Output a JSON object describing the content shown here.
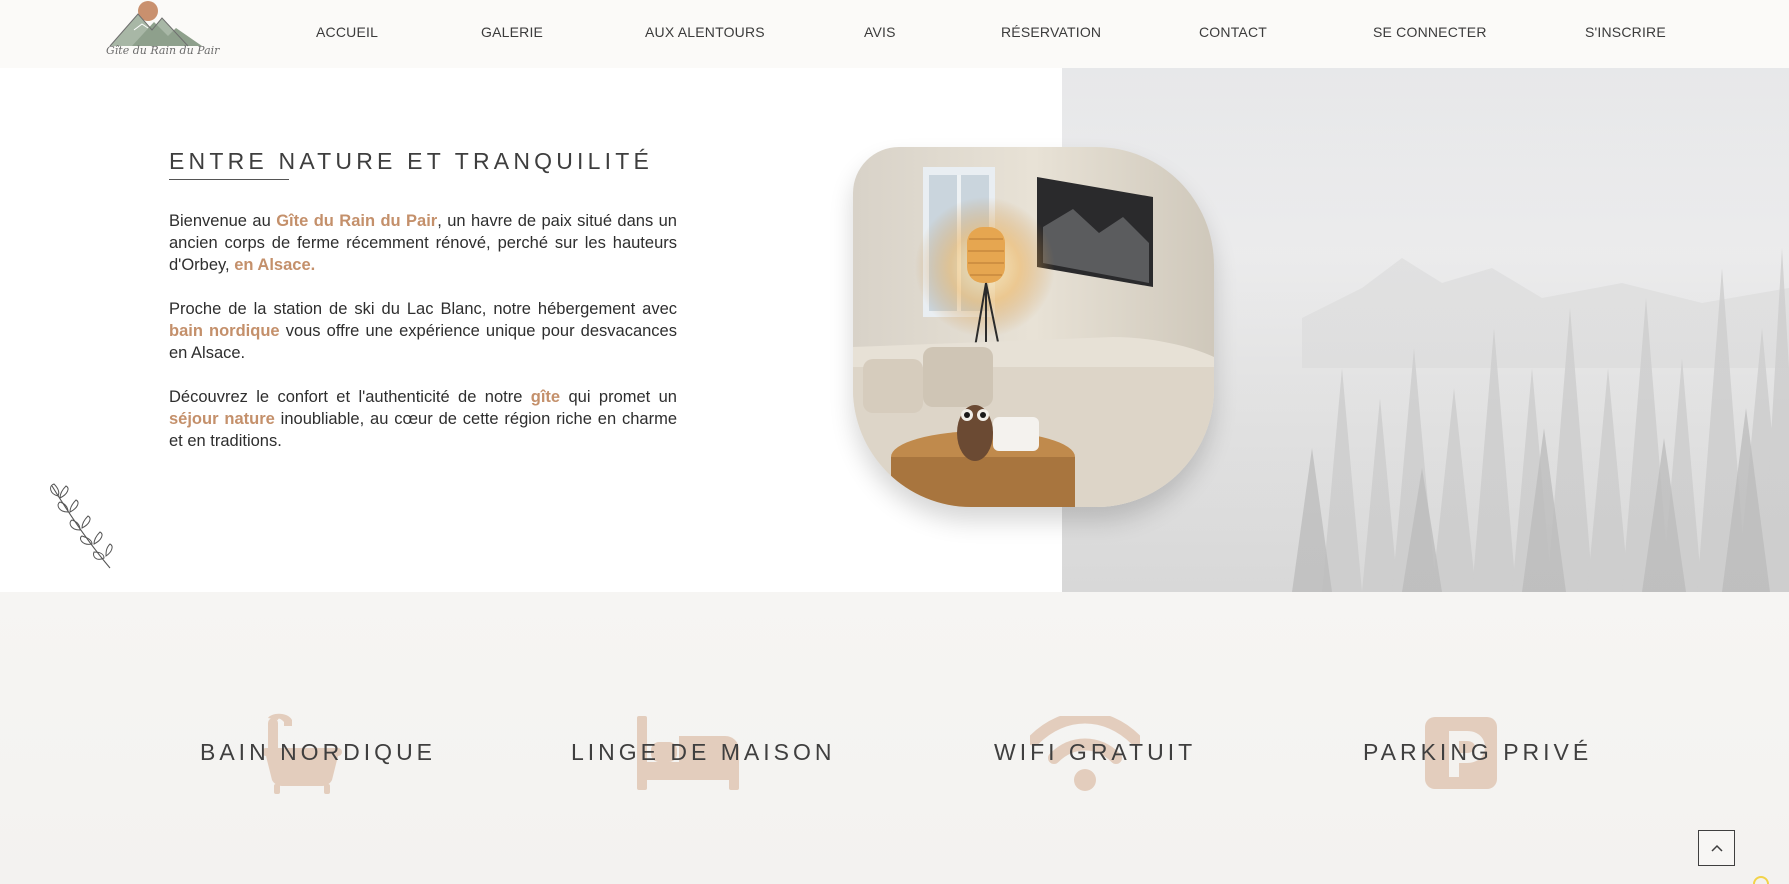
{
  "logo": {
    "text": "Gîte du Rain du Pair"
  },
  "nav": {
    "items": [
      "ACCUEIL",
      "GALERIE",
      "AUX ALENTOURS",
      "AVIS",
      "RÉSERVATION",
      "CONTACT",
      "SE CONNECTER",
      "S'INSCRIRE"
    ]
  },
  "hero": {
    "title": "ENTRE NATURE ET TRANQUILITÉ",
    "p1": {
      "a": "Bienvenue au ",
      "b": "Gîte du Rain du Pair",
      "c": ", un havre de paix situé dans un ancien corps de ferme récemment rénové, perché sur les hauteurs d'Orbey, ",
      "d": "en Alsace."
    },
    "p2": {
      "a": "Proche de la station de ski du Lac Blanc, notre hébergement avec ",
      "b": "bain nordique",
      "c": " vous offre une expérience unique pour desvacances en Alsace."
    },
    "p3": {
      "a": "Découvrez le confort et l'authenticité de notre ",
      "b": "gîte",
      "c": " qui promet un ",
      "d": "séjour nature",
      "e": " inoubliable, au cœur de cette région riche en charme et en traditions."
    }
  },
  "amenities": [
    {
      "label": "BAIN NORDIQUE",
      "icon": "bathtub-icon"
    },
    {
      "label": "LINGE DE MAISON",
      "icon": "bed-icon"
    },
    {
      "label": "WIFI GRATUIT",
      "icon": "wifi-icon"
    },
    {
      "label": "PARKING PRIVÉ",
      "icon": "parking-icon"
    }
  ],
  "colors": {
    "accent": "#c4906b",
    "icon_tint": "#e3cdbd",
    "text": "#3e3e3e"
  }
}
